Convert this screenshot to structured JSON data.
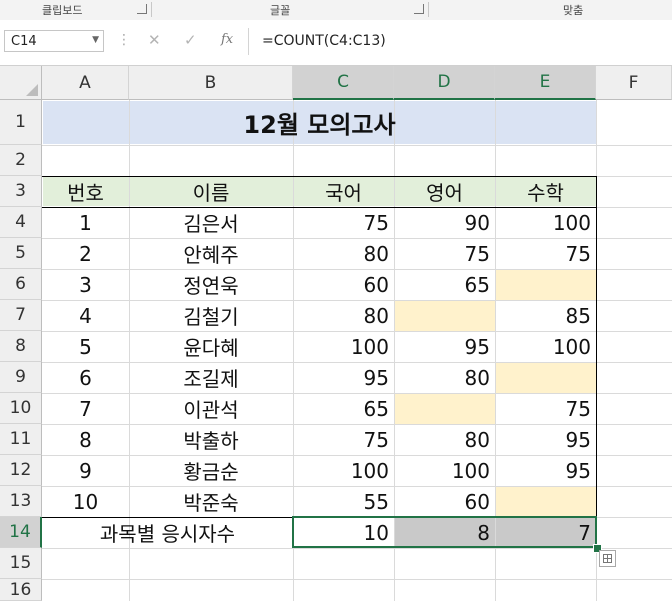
{
  "ribbon": {
    "groups": [
      "클립보드",
      "글꼴",
      "맞춤"
    ]
  },
  "formula_bar": {
    "name_box": "C14",
    "formula": "=COUNT(C4:C13)",
    "fx_label": "fx",
    "cancel_icon": "✕",
    "enter_icon": "✓"
  },
  "columns": [
    "A",
    "B",
    "C",
    "D",
    "E",
    "F"
  ],
  "rows": [
    "1",
    "2",
    "3",
    "4",
    "5",
    "6",
    "7",
    "8",
    "9",
    "10",
    "11",
    "12",
    "13",
    "14",
    "15",
    "16"
  ],
  "sheet": {
    "title": "12월 모의고사",
    "headers": [
      "번호",
      "이름",
      "국어",
      "영어",
      "수학"
    ],
    "records": [
      {
        "no": "1",
        "name": "김은서",
        "kor": "75",
        "eng": "90",
        "math": "100"
      },
      {
        "no": "2",
        "name": "안혜주",
        "kor": "80",
        "eng": "75",
        "math": "75"
      },
      {
        "no": "3",
        "name": "정연욱",
        "kor": "60",
        "eng": "65",
        "math": ""
      },
      {
        "no": "4",
        "name": "김철기",
        "kor": "80",
        "eng": "",
        "math": "85"
      },
      {
        "no": "5",
        "name": "윤다혜",
        "kor": "100",
        "eng": "95",
        "math": "100"
      },
      {
        "no": "6",
        "name": "조길제",
        "kor": "95",
        "eng": "80",
        "math": ""
      },
      {
        "no": "7",
        "name": "이관석",
        "kor": "65",
        "eng": "",
        "math": "75"
      },
      {
        "no": "8",
        "name": "박출하",
        "kor": "75",
        "eng": "80",
        "math": "95"
      },
      {
        "no": "9",
        "name": "황금순",
        "kor": "100",
        "eng": "100",
        "math": "95"
      },
      {
        "no": "10",
        "name": "박준숙",
        "kor": "55",
        "eng": "60",
        "math": ""
      }
    ],
    "summary": {
      "label": "과목별 응시자수",
      "kor": "10",
      "eng": "8",
      "math": "7"
    }
  },
  "colors": {
    "title_fill": "#dae3f3",
    "header_fill": "#e2efda",
    "blank_fill": "#fff2cc",
    "summary_fill": "#c9c9c9",
    "selection": "#217346"
  }
}
